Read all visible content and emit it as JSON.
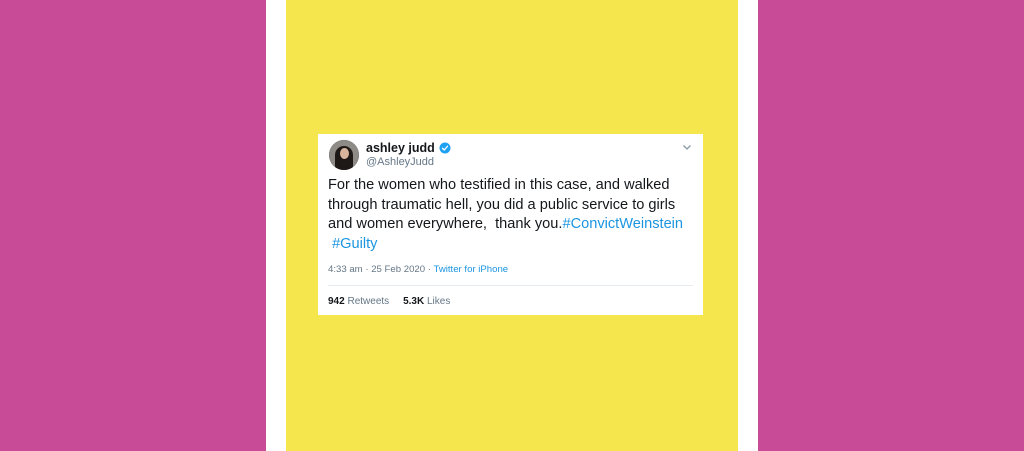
{
  "colors": {
    "magenta": "#c84b98",
    "yellow": "#f4e64c",
    "white": "#ffffff",
    "link": "#1b95e0"
  },
  "tweet": {
    "name": "ashley judd",
    "handle": "@AshleyJudd",
    "verified_icon": "verified-badge-icon",
    "text": "For the women who testified in this case, and walked through traumatic hell, you did a public service to girls and women everywhere,  thank you.",
    "hashtag_1": "#ConvictWeinstein",
    "hashtag_2": "#Guilty",
    "time": "4:33 am",
    "date": "25 Feb 2020",
    "meta_separator": "·",
    "source": "Twitter for iPhone",
    "retweets_count": "942",
    "retweets_label": "Retweets",
    "likes_count": "5.3K",
    "likes_label": "Likes"
  }
}
